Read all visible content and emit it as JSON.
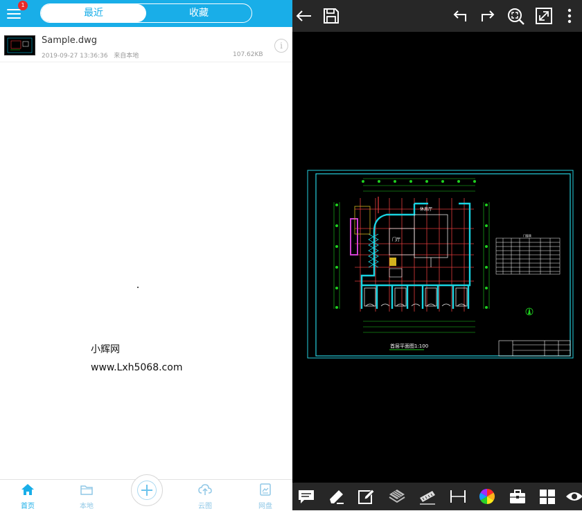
{
  "left_panel": {
    "header": {
      "menu_icon": "hamburger-menu-icon",
      "notification_count": "1",
      "tabs": [
        {
          "label": "最近",
          "active": true
        },
        {
          "label": "收藏",
          "active": false
        }
      ],
      "accent_color": "#19aee8"
    },
    "files": [
      {
        "name": "Sample.dwg",
        "modified": "2019-09-27 13:36:36",
        "source": "来自本地",
        "size": "107.62KB",
        "info_icon": "info-icon"
      }
    ],
    "watermark": {
      "line1": "小辉网",
      "line2": "www.Lxh5068.com"
    },
    "bottom_nav": [
      {
        "label": "首页",
        "icon": "home-icon",
        "active": true
      },
      {
        "label": "本地",
        "icon": "folder-icon",
        "active": false
      },
      {
        "label": "",
        "icon": "add-icon",
        "active": false
      },
      {
        "label": "云图",
        "icon": "cloud-upload-icon",
        "active": false
      },
      {
        "label": "网盘",
        "icon": "netdisk-icon",
        "active": false
      }
    ]
  },
  "right_panel": {
    "top_toolbar": [
      {
        "icon": "back-arrow-icon"
      },
      {
        "icon": "save-icon"
      },
      {
        "icon": "undo-icon"
      },
      {
        "icon": "redo-icon"
      },
      {
        "icon": "zoom-extents-icon"
      },
      {
        "icon": "fullscreen-icon"
      },
      {
        "icon": "more-vertical-icon"
      }
    ],
    "drawing": {
      "title_text": "首层平面图1:100",
      "room_label_1": "休息厅",
      "room_label_2": "门厅",
      "table_title": "门窗表"
    },
    "bottom_toolbar": [
      {
        "icon": "comment-icon"
      },
      {
        "icon": "markup-pen-icon"
      },
      {
        "icon": "edit-icon"
      },
      {
        "icon": "layers-icon"
      },
      {
        "icon": "measure-ruler-icon"
      },
      {
        "icon": "dimension-icon"
      },
      {
        "icon": "color-wheel-icon"
      },
      {
        "icon": "toolbox-icon"
      },
      {
        "icon": "layout-grid-icon"
      },
      {
        "icon": "view-eye-icon"
      }
    ]
  }
}
